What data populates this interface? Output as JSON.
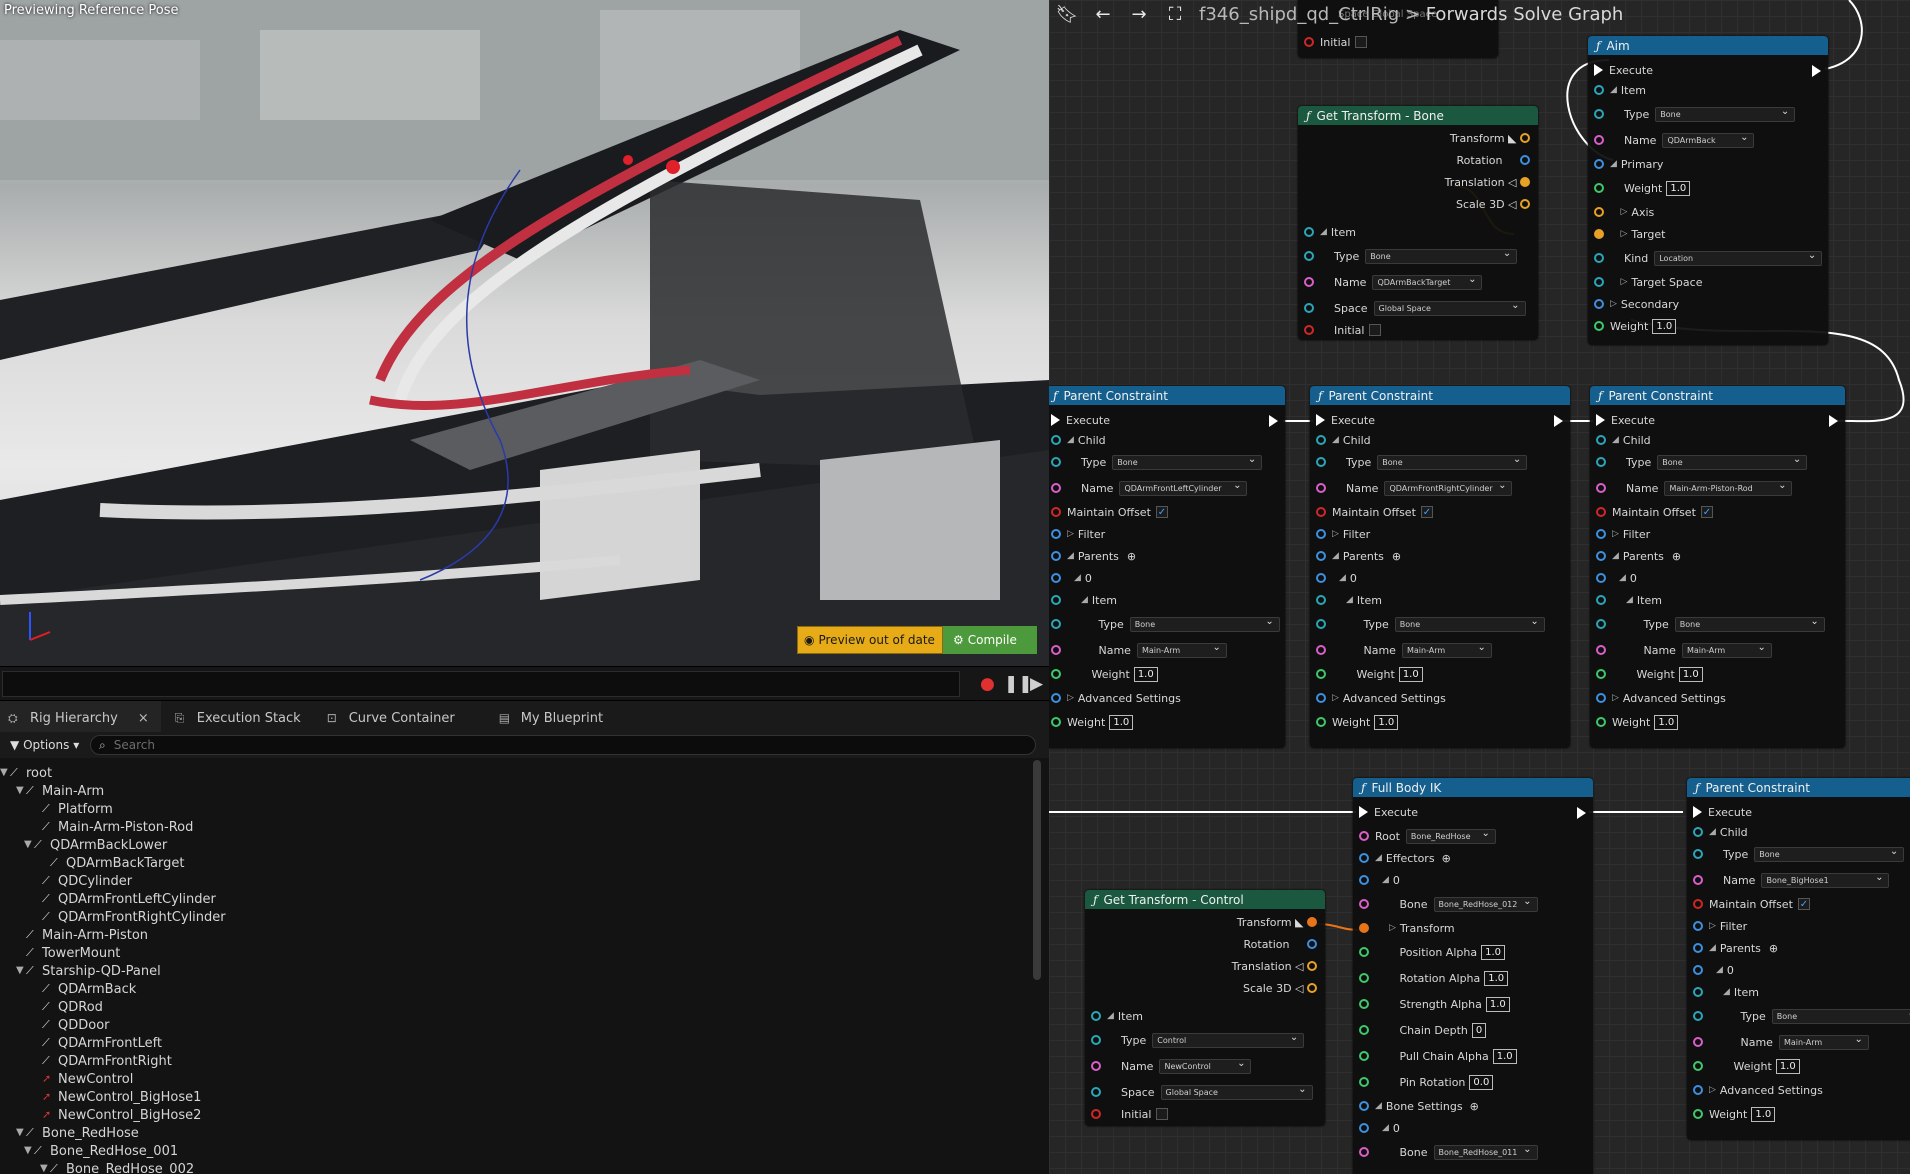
{
  "viewport": {
    "label": "Previewing Reference Pose",
    "preview_button": "Preview out of date",
    "compile_button": "Compile",
    "colors": {
      "preview": "#e6ab16",
      "compile": "#4c9a3c"
    }
  },
  "tabs": [
    {
      "label": "Rig Hierarchy",
      "icon": "hierarchy-icon"
    },
    {
      "label": "Execution Stack",
      "icon": "stack-icon"
    },
    {
      "label": "Curve Container",
      "icon": "curve-icon"
    },
    {
      "label": "My Blueprint",
      "icon": "blueprint-icon"
    }
  ],
  "options": {
    "label": "Options",
    "search_placeholder": "Search"
  },
  "hierarchy": [
    {
      "label": "root",
      "type": "bone"
    },
    {
      "label": "Main-Arm",
      "type": "bone"
    },
    {
      "label": "Platform",
      "type": "bone"
    },
    {
      "label": "Main-Arm-Piston-Rod",
      "type": "bone"
    },
    {
      "label": "QDArmBackLower",
      "type": "bone"
    },
    {
      "label": "QDArmBackTarget",
      "type": "bone"
    },
    {
      "label": "QDCylinder",
      "type": "bone"
    },
    {
      "label": "QDArmFrontLeftCylinder",
      "type": "bone"
    },
    {
      "label": "QDArmFrontRightCylinder",
      "type": "bone"
    },
    {
      "label": "Main-Arm-Piston",
      "type": "bone"
    },
    {
      "label": "TowerMount",
      "type": "bone"
    },
    {
      "label": "Starship-QD-Panel",
      "type": "bone"
    },
    {
      "label": "QDArmBack",
      "type": "bone"
    },
    {
      "label": "QDRod",
      "type": "bone"
    },
    {
      "label": "QDDoor",
      "type": "bone"
    },
    {
      "label": "QDArmFrontLeft",
      "type": "bone"
    },
    {
      "label": "QDArmFrontRight",
      "type": "bone"
    },
    {
      "label": "NewControl",
      "type": "control"
    },
    {
      "label": "NewControl_BigHose1",
      "type": "control"
    },
    {
      "label": "NewControl_BigHose2",
      "type": "control"
    },
    {
      "label": "Bone_RedHose",
      "type": "bone"
    },
    {
      "label": "Bone_RedHose_001",
      "type": "bone"
    },
    {
      "label": "Bone_RedHose_002",
      "type": "bone"
    }
  ],
  "graph": {
    "breadcrumb_asset": "f346_shipd_qd_CtrlRig",
    "breadcrumb_sep": ">",
    "breadcrumb_graph": "Forwards Solve Graph",
    "top_node": {
      "space_label": "Space",
      "space_value": "Global Space",
      "initial": "Initial",
      "weight": "Weight",
      "weight_value": "1.0"
    },
    "get_transform_bone": {
      "title": "Get Transform - Bone",
      "outputs": [
        "Transform",
        "Rotation",
        "Translation",
        "Scale 3D"
      ],
      "item": "Item",
      "type": "Type",
      "type_value": "Bone",
      "name": "Name",
      "name_value": "QDArmBackTarget",
      "space": "Space",
      "space_value": "Global Space",
      "initial": "Initial"
    },
    "aim": {
      "title": "Aim",
      "execute": "Execute",
      "item": "Item",
      "type": "Type",
      "type_value": "Bone",
      "name": "Name",
      "name_value": "QDArmBack",
      "primary": "Primary",
      "weight": "Weight",
      "weight_value": "1.0",
      "axis": "Axis",
      "target": "Target",
      "kind": "Kind",
      "kind_value": "Location",
      "target_space": "Target Space",
      "secondary": "Secondary",
      "weight2": "Weight",
      "weight2_value": "1.0"
    },
    "parent_constraints": [
      {
        "title": "Parent Constraint",
        "name_value": "QDArmFrontLeftCylinder",
        "parent_name": "Main-Arm"
      },
      {
        "title": "Parent Constraint",
        "name_value": "QDArmFrontRightCylinder",
        "parent_name": "Main-Arm"
      },
      {
        "title": "Parent Constraint",
        "name_value": "Main-Arm-Piston-Rod",
        "parent_name": "Main-Arm"
      }
    ],
    "pc_labels": {
      "execute": "Execute",
      "child": "Child",
      "type": "Type",
      "type_value": "Bone",
      "name": "Name",
      "maintain_offset": "Maintain Offset",
      "filter": "Filter",
      "parents": "Parents",
      "index0": "0",
      "item": "Item",
      "weight": "Weight",
      "weight_value": "1.0",
      "advanced": "Advanced Settings"
    },
    "full_body_ik": {
      "title": "Full Body IK",
      "execute": "Execute",
      "root": "Root",
      "root_value": "Bone_RedHose",
      "effectors": "Effectors",
      "index0": "0",
      "bone": "Bone",
      "bone_value": "Bone_RedHose_012",
      "transform": "Transform",
      "position_alpha": "Position Alpha",
      "position_alpha_value": "1.0",
      "rotation_alpha": "Rotation Alpha",
      "rotation_alpha_value": "1.0",
      "strength_alpha": "Strength Alpha",
      "strength_alpha_value": "1.0",
      "chain_depth": "Chain Depth",
      "chain_depth_value": "0",
      "pull_chain_alpha": "Pull Chain Alpha",
      "pull_chain_alpha_value": "1.0",
      "pin_rotation": "Pin Rotation",
      "pin_rotation_value": "0.0",
      "bone_settings": "Bone Settings",
      "bs_index0": "0",
      "bs_bone": "Bone",
      "bs_bone_value": "Bone_RedHose_011"
    },
    "get_transform_control": {
      "title": "Get Transform - Control",
      "outputs": [
        "Transform",
        "Rotation",
        "Translation",
        "Scale 3D"
      ],
      "item": "Item",
      "type": "Type",
      "type_value": "Control",
      "name": "Name",
      "name_value": "NewControl",
      "space": "Space",
      "space_value": "Global Space",
      "initial": "Initial"
    },
    "parent_constraint_4": {
      "title": "Parent Constraint",
      "name_value": "Bone_BigHose1",
      "parent_name": "Main-Arm"
    }
  }
}
